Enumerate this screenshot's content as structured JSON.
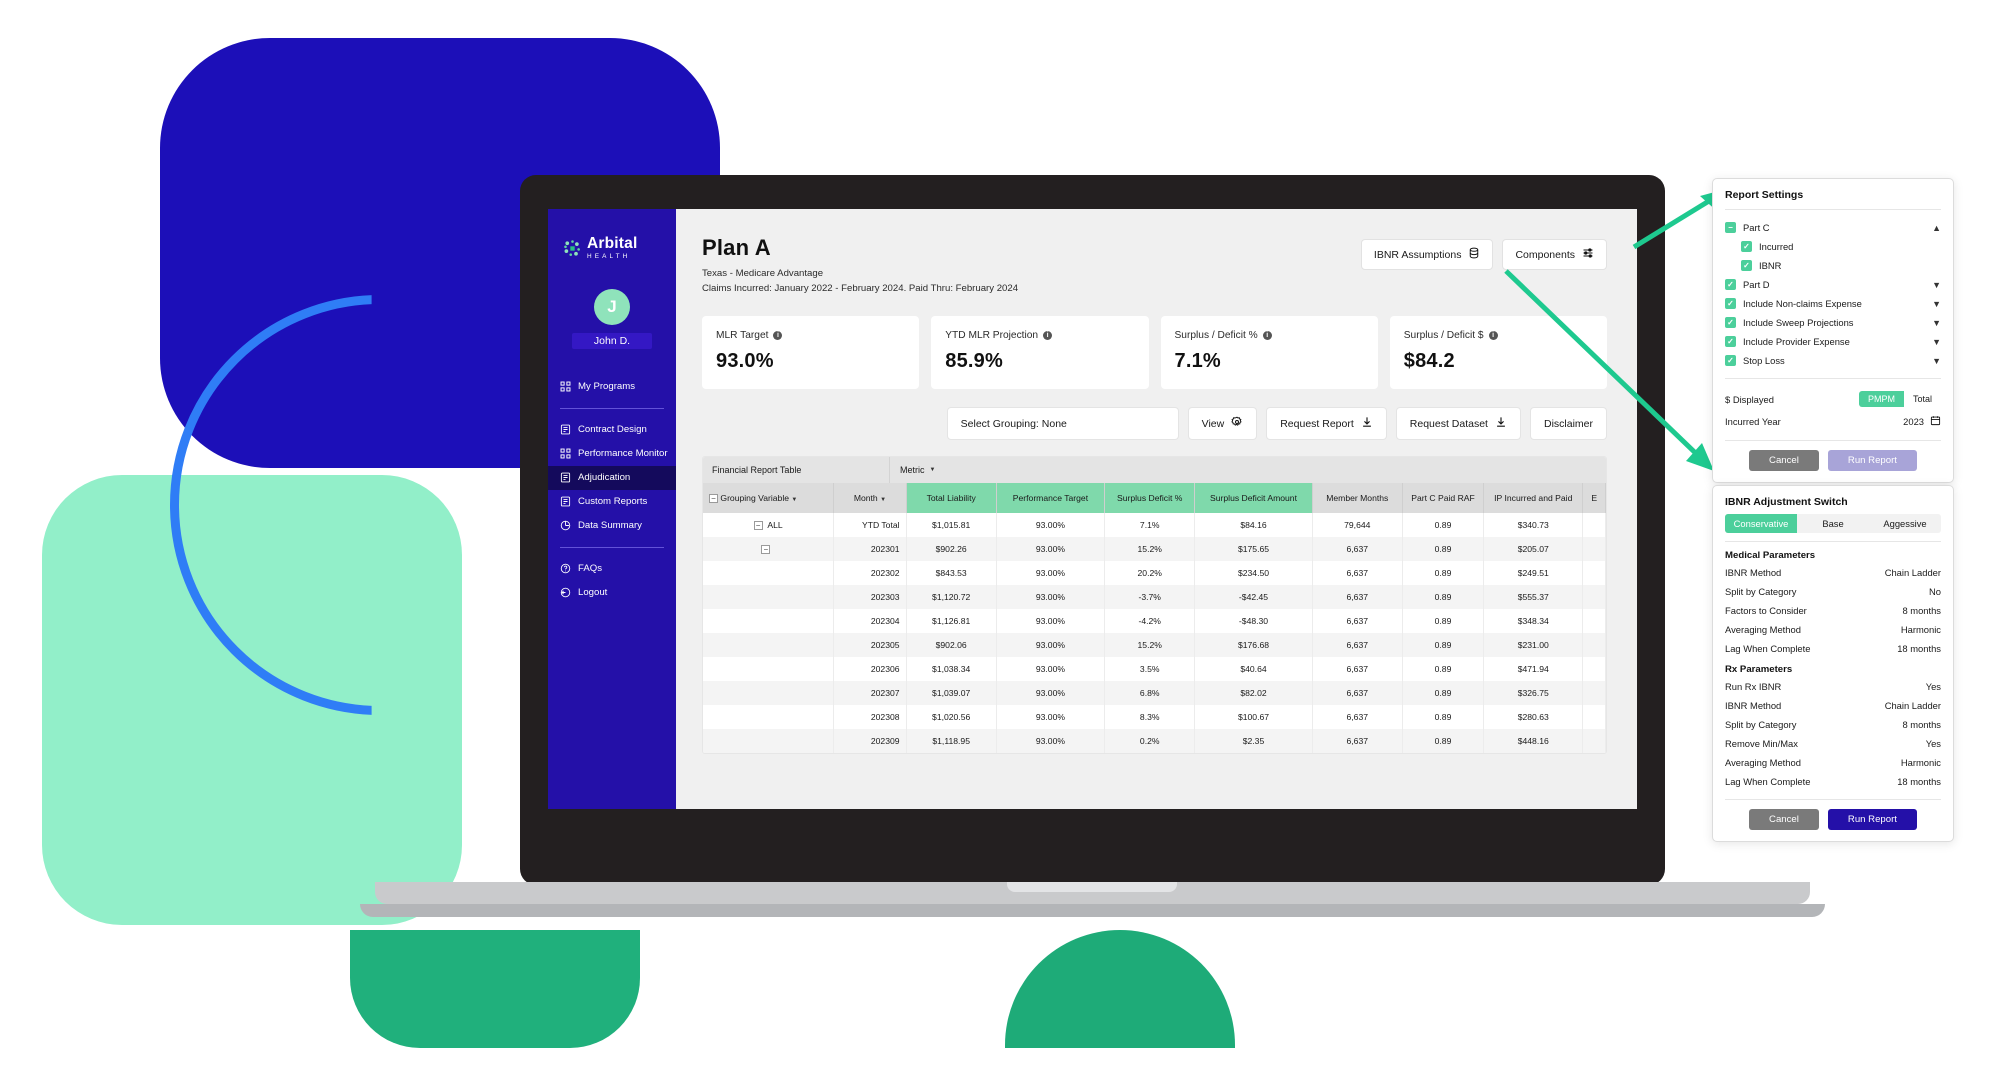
{
  "brand": {
    "name": "Arbital",
    "subtitle": "HEALTH",
    "primary": "#2410a8",
    "accent": "#4ccf9b"
  },
  "sidebar": {
    "user": {
      "initial": "J",
      "name": "John D."
    },
    "items": [
      {
        "label": "My Programs",
        "icon": "grid-icon",
        "active": false
      },
      {
        "label": "Contract Design",
        "icon": "document-icon",
        "active": false
      },
      {
        "label": "Performance Monitor",
        "icon": "grid-icon",
        "active": false
      },
      {
        "label": "Adjudication",
        "icon": "document-icon",
        "active": true
      },
      {
        "label": "Custom Reports",
        "icon": "document-icon",
        "active": false
      },
      {
        "label": "Data Summary",
        "icon": "pie-clock-icon",
        "active": false
      },
      {
        "label": "FAQs",
        "icon": "question-circle-icon",
        "active": false
      },
      {
        "label": "Logout",
        "icon": "logout-icon",
        "active": false
      }
    ]
  },
  "header": {
    "title": "Plan A",
    "subtitle": "Texas - Medicare Advantage",
    "claims_line": "Claims Incurred: January 2022 - February 2024. Paid Thru: February 2024",
    "buttons": [
      {
        "label": "IBNR Assumptions",
        "icon": "database-icon"
      },
      {
        "label": "Components",
        "icon": "sliders-icon"
      }
    ]
  },
  "metrics": [
    {
      "label": "MLR Target",
      "value": "93.0%"
    },
    {
      "label": "YTD MLR Projection",
      "value": "85.9%"
    },
    {
      "label": "Surplus / Deficit %",
      "value": "7.1%"
    },
    {
      "label": "Surplus / Deficit $",
      "value": "$84.2"
    }
  ],
  "actionbar": [
    {
      "label": "Select Grouping: None",
      "icon": ""
    },
    {
      "label": "View",
      "icon": "gear-icon"
    },
    {
      "label": "Request Report",
      "icon": "download-icon"
    },
    {
      "label": "Request Dataset",
      "icon": "download-icon"
    },
    {
      "label": "Disclaimer",
      "icon": ""
    }
  ],
  "table": {
    "toolbar_title": "Financial Report Table",
    "metric_label": "Metric",
    "columns": [
      {
        "label": "Grouping Variable",
        "green": false,
        "lead": true
      },
      {
        "label": "Month",
        "green": false,
        "lead": false
      },
      {
        "label": "Total Liability",
        "green": true,
        "lead": false
      },
      {
        "label": "Performance Target",
        "green": true,
        "lead": false
      },
      {
        "label": "Surplus Deficit %",
        "green": true,
        "lead": false
      },
      {
        "label": "Surplus Deficit Amount",
        "green": true,
        "lead": false
      },
      {
        "label": "Member Months",
        "green": false,
        "lead": false
      },
      {
        "label": "Part C Paid RAF",
        "green": false,
        "lead": false
      },
      {
        "label": "IP Incurred and Paid",
        "green": false,
        "lead": false
      },
      {
        "label": "E",
        "green": false,
        "lead": false
      }
    ],
    "rows": [
      {
        "expander": true,
        "group": "ALL",
        "month": "YTD Total",
        "total_liability": "$1,015.81",
        "performance_target": "93.00%",
        "surplus_deficit_pct": "7.1%",
        "surplus_deficit_amount": "$84.16",
        "member_months": "79,644",
        "part_c_paid_raf": "0.89",
        "ip_incurred_and_paid": "$340.73",
        "extra": ""
      },
      {
        "expander": true,
        "group": "",
        "month": "202301",
        "total_liability": "$902.26",
        "performance_target": "93.00%",
        "surplus_deficit_pct": "15.2%",
        "surplus_deficit_amount": "$175.65",
        "member_months": "6,637",
        "part_c_paid_raf": "0.89",
        "ip_incurred_and_paid": "$205.07",
        "extra": ""
      },
      {
        "expander": false,
        "group": "",
        "month": "202302",
        "total_liability": "$843.53",
        "performance_target": "93.00%",
        "surplus_deficit_pct": "20.2%",
        "surplus_deficit_amount": "$234.50",
        "member_months": "6,637",
        "part_c_paid_raf": "0.89",
        "ip_incurred_and_paid": "$249.51",
        "extra": ""
      },
      {
        "expander": false,
        "group": "",
        "month": "202303",
        "total_liability": "$1,120.72",
        "performance_target": "93.00%",
        "surplus_deficit_pct": "-3.7%",
        "surplus_deficit_amount": "-$42.45",
        "member_months": "6,637",
        "part_c_paid_raf": "0.89",
        "ip_incurred_and_paid": "$555.37",
        "extra": ""
      },
      {
        "expander": false,
        "group": "",
        "month": "202304",
        "total_liability": "$1,126.81",
        "performance_target": "93.00%",
        "surplus_deficit_pct": "-4.2%",
        "surplus_deficit_amount": "-$48.30",
        "member_months": "6,637",
        "part_c_paid_raf": "0.89",
        "ip_incurred_and_paid": "$348.34",
        "extra": ""
      },
      {
        "expander": false,
        "group": "",
        "month": "202305",
        "total_liability": "$902.06",
        "performance_target": "93.00%",
        "surplus_deficit_pct": "15.2%",
        "surplus_deficit_amount": "$176.68",
        "member_months": "6,637",
        "part_c_paid_raf": "0.89",
        "ip_incurred_and_paid": "$231.00",
        "extra": ""
      },
      {
        "expander": false,
        "group": "",
        "month": "202306",
        "total_liability": "$1,038.34",
        "performance_target": "93.00%",
        "surplus_deficit_pct": "3.5%",
        "surplus_deficit_amount": "$40.64",
        "member_months": "6,637",
        "part_c_paid_raf": "0.89",
        "ip_incurred_and_paid": "$471.94",
        "extra": ""
      },
      {
        "expander": false,
        "group": "",
        "month": "202307",
        "total_liability": "$1,039.07",
        "performance_target": "93.00%",
        "surplus_deficit_pct": "6.8%",
        "surplus_deficit_amount": "$82.02",
        "member_months": "6,637",
        "part_c_paid_raf": "0.89",
        "ip_incurred_and_paid": "$326.75",
        "extra": ""
      },
      {
        "expander": false,
        "group": "",
        "month": "202308",
        "total_liability": "$1,020.56",
        "performance_target": "93.00%",
        "surplus_deficit_pct": "8.3%",
        "surplus_deficit_amount": "$100.67",
        "member_months": "6,637",
        "part_c_paid_raf": "0.89",
        "ip_incurred_and_paid": "$280.63",
        "extra": ""
      },
      {
        "expander": false,
        "group": "",
        "month": "202309",
        "total_liability": "$1,118.95",
        "performance_target": "93.00%",
        "surplus_deficit_pct": "0.2%",
        "surplus_deficit_amount": "$2.35",
        "member_months": "6,637",
        "part_c_paid_raf": "0.89",
        "ip_incurred_and_paid": "$448.16",
        "extra": ""
      }
    ]
  },
  "report_settings": {
    "title": "Report Settings",
    "tree": [
      {
        "label": "Part C",
        "checked": "indeterminate",
        "chevron": "up",
        "indent": false
      },
      {
        "label": "Incurred",
        "checked": "checked",
        "chevron": "",
        "indent": true
      },
      {
        "label": "IBNR",
        "checked": "checked",
        "chevron": "",
        "indent": true
      },
      {
        "label": "Part D",
        "checked": "checked",
        "chevron": "down",
        "indent": false
      },
      {
        "label": "Include Non-claims Expense",
        "checked": "checked",
        "chevron": "down",
        "indent": false
      },
      {
        "label": "Include Sweep Projections",
        "checked": "checked",
        "chevron": "down",
        "indent": false
      },
      {
        "label": "Include Provider Expense",
        "checked": "checked",
        "chevron": "down",
        "indent": false
      },
      {
        "label": "Stop Loss",
        "checked": "checked",
        "chevron": "down",
        "indent": false
      }
    ],
    "dollar_displayed_label": "$ Displayed",
    "dollar_options": [
      "PMPM",
      "Total"
    ],
    "dollar_selected": "PMPM",
    "incurred_year_label": "Incurred Year",
    "incurred_year_value": "2023",
    "cancel_label": "Cancel",
    "run_label": "Run Report"
  },
  "ibnr_panel": {
    "title": "IBNR Adjustment Switch",
    "switch_options": [
      "Conservative",
      "Base",
      "Aggessive"
    ],
    "switch_selected": "Conservative",
    "medical_title": "Medical Parameters",
    "medical_params": [
      {
        "key": "IBNR Method",
        "value": "Chain Ladder"
      },
      {
        "key": "Split by Category",
        "value": "No"
      },
      {
        "key": "Factors to Consider",
        "value": "8 months"
      },
      {
        "key": "Averaging Method",
        "value": "Harmonic"
      },
      {
        "key": "Lag When Complete",
        "value": "18 months"
      }
    ],
    "rx_title": "Rx Parameters",
    "rx_params": [
      {
        "key": "Run Rx IBNR",
        "value": "Yes"
      },
      {
        "key": "IBNR Method",
        "value": "Chain Ladder"
      },
      {
        "key": "Split by Category",
        "value": "8 months"
      },
      {
        "key": "Remove Min/Max",
        "value": "Yes"
      },
      {
        "key": "Averaging Method",
        "value": "Harmonic"
      },
      {
        "key": "Lag When Complete",
        "value": "18 months"
      }
    ],
    "cancel_label": "Cancel",
    "run_label": "Run Report"
  }
}
